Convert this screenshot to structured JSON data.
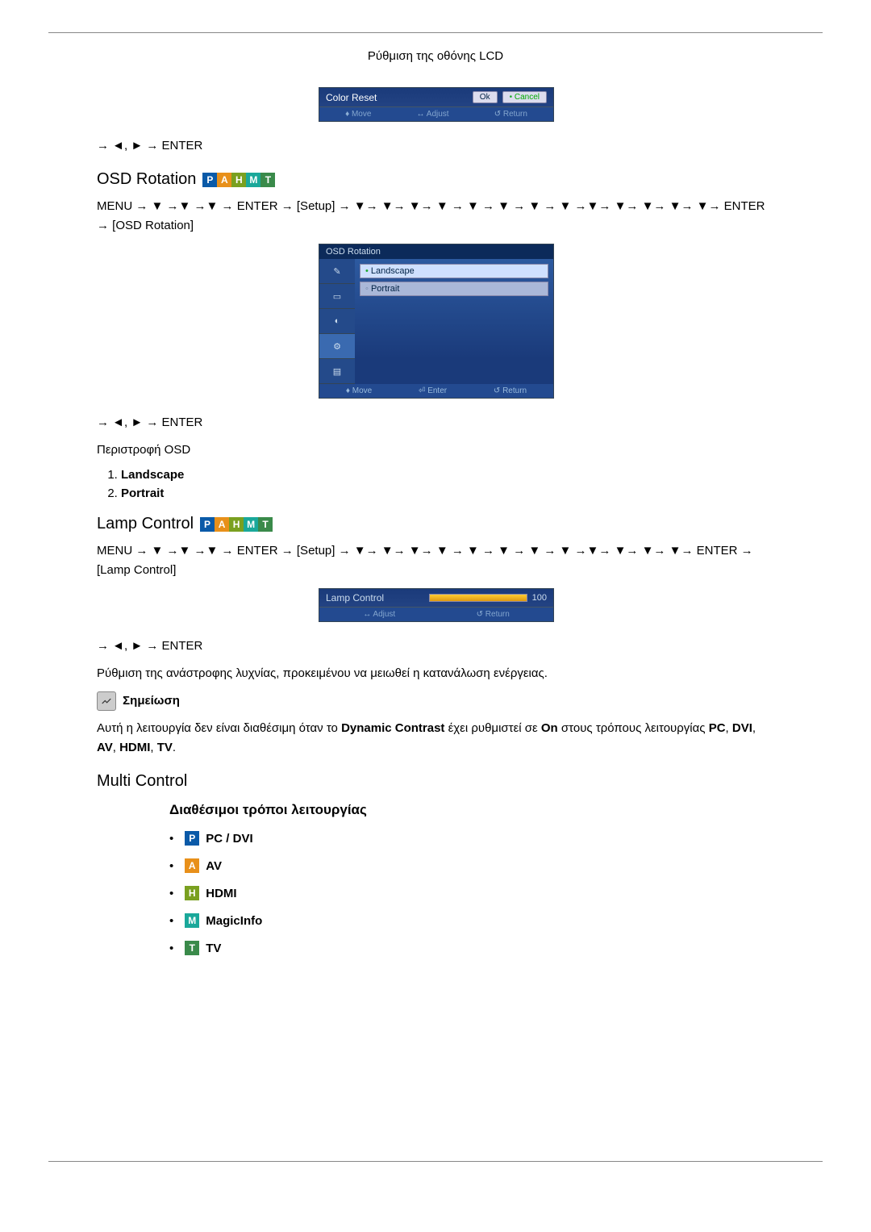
{
  "page": {
    "title": "Ρύθμιση της οθόνης LCD"
  },
  "colorReset": {
    "label": "Color Reset",
    "ok": "Ok",
    "cancel": "Cancel",
    "footer": {
      "move": "Move",
      "adjust": "Adjust",
      "return": "Return"
    }
  },
  "nav_short": "→ ◄, ► → ENTER",
  "osdRotation": {
    "heading": "OSD Rotation",
    "menuPath1": "MENU → ▼ →▼ →▼ → ENTER → ",
    "menuPathSetup": "[Setup]",
    "menuPath2": " → ▼→ ▼→ ▼→ ▼ → ▼ → ▼ → ▼ → ▼ →▼→ ▼→ ▼→ ▼→ ▼→ ENTER → ",
    "menuPathTarget": "[OSD Rotation]",
    "menuTitle": "OSD Rotation",
    "optLandscape": "Landscape",
    "optPortrait": "Portrait",
    "footer": {
      "move": "Move",
      "enter": "Enter",
      "return": "Return"
    },
    "desc": "Περιστροφή OSD",
    "list": {
      "i1": "Landscape",
      "i2": "Portrait"
    }
  },
  "lampControl": {
    "heading": "Lamp Control",
    "menuPath1": "MENU → ▼ →▼ →▼ → ENTER → ",
    "menuPathSetup": "[Setup]",
    "menuPath2": " → ▼→ ▼→ ▼→ ▼ → ▼ → ▼ → ▼ → ▼ →▼→ ▼→ ▼→ ▼→ ENTER → ",
    "menuPathTarget": "[Lamp Control]",
    "osdLabel": "Lamp Control",
    "osdValue": "100",
    "footer": {
      "adjust": "Adjust",
      "return": "Return"
    },
    "desc": "Ρύθμιση της ανάστροφης λυχνίας, προκειμένου να μειωθεί η κατανάλωση ενέργειας.",
    "noteLabel": "Σημείωση",
    "noteText1": "Αυτή η λειτουργία δεν είναι διαθέσιμη όταν το ",
    "noteBold1": "Dynamic Contrast",
    "noteText2": " έχει ρυθμιστεί σε ",
    "noteBold2": "On",
    "noteText3": " στους τρόπους λειτουργίας ",
    "noteBold3": "PC",
    "noteBold4": "DVI",
    "noteBold5": "AV",
    "noteBold6": "HDMI",
    "noteBold7": "TV",
    "sep": ", ",
    "period": "."
  },
  "multiControl": {
    "heading": "Multi Control",
    "subheading": "Διαθέσιμοι τρόποι λειτουργίας",
    "modes": {
      "pc": "PC / DVI",
      "av": "AV",
      "hdmi": "HDMI",
      "magic": "MagicInfo",
      "tv": "TV"
    }
  },
  "badges": {
    "P": "P",
    "A": "A",
    "H": "H",
    "M": "M",
    "T": "T"
  }
}
